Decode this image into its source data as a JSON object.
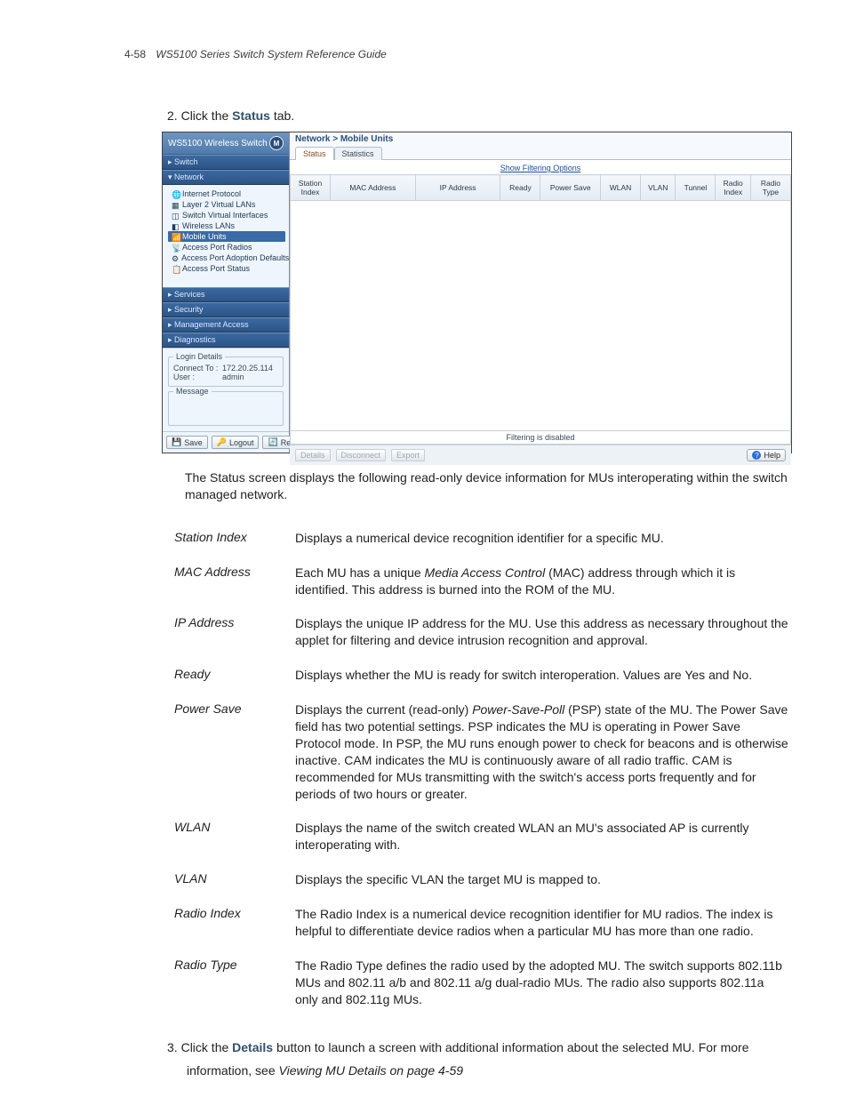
{
  "header": {
    "page_no": "4-58",
    "title": "WS5100 Series Switch System Reference Guide"
  },
  "step2": {
    "num": "2.",
    "pre": "Click the ",
    "bold": "Status",
    "post": " tab."
  },
  "shot": {
    "nav_title": "WS5100 Wireless Switch",
    "logo": "M",
    "band_switch": "▸  Switch",
    "band_network": "▾  Network",
    "tree": [
      "Internet Protocol",
      "Layer 2 Virtual LANs",
      "Switch Virtual Interfaces",
      "Wireless LANs",
      "Mobile Units",
      "Access Port Radios",
      "Access Port Adoption Defaults",
      "Access Port Status"
    ],
    "band_services": "▸  Services",
    "band_security": "▸  Security",
    "band_mgmt": "▸  Management Access",
    "band_diag": "▸  Diagnostics",
    "login_legend": "Login Details",
    "login_connect_lbl": "Connect To :",
    "login_connect_val": "172.20.25.114",
    "login_user_lbl": "User :",
    "login_user_val": "admin",
    "msg_legend": "Message",
    "btn_save": "Save",
    "btn_logout": "Logout",
    "btn_refresh": "Refresh",
    "crumbs": "Network > Mobile Units",
    "tab_status": "Status",
    "tab_stats": "Statistics",
    "filter_link": "Show Filtering Options",
    "cols": [
      "Station Index",
      "MAC Address",
      "IP Address",
      "Ready",
      "Power Save",
      "WLAN",
      "VLAN",
      "Tunnel",
      "Radio Index",
      "Radio Type"
    ],
    "filter_off": "Filtering is disabled",
    "btn_details": "Details",
    "btn_disconnect": "Disconnect",
    "btn_export": "Export",
    "btn_help": "Help"
  },
  "prose_status": "The Status screen displays the following read-only device information for MUs interoperating within the switch managed network.",
  "defs": [
    {
      "term": "Station Index",
      "def": "Displays a numerical device recognition identifier for a specific MU."
    },
    {
      "term": "MAC Address",
      "def": "Each MU has a unique <span class='it'>Media Access Control</span> (MAC) address through which it is identified. This address is burned into the ROM of the MU."
    },
    {
      "term": "IP Address",
      "def": "Displays the unique IP address for the MU. Use this address as necessary throughout the applet for filtering and device intrusion recognition and approval."
    },
    {
      "term": "Ready",
      "def": "Displays whether the MU is ready for switch interoperation. Values are Yes and No."
    },
    {
      "term": "Power Save",
      "def": "Displays the current (read-only) <span class='it'>Power-Save-Poll</span> (PSP) state of the MU. The Power Save field has two potential settings. PSP indicates the MU is operating in Power Save Protocol mode. In PSP, the MU runs enough power to check for beacons and is otherwise inactive. CAM indicates the MU is continuously aware of all radio traffic. CAM is recommended for MUs transmitting with the switch's access ports frequently and for periods of two hours or greater."
    },
    {
      "term": "WLAN",
      "def": "Displays the name of the switch created WLAN an MU's associated AP is currently interoperating with."
    },
    {
      "term": "VLAN",
      "def": "Displays the specific VLAN the target MU is mapped to."
    },
    {
      "term": "Radio Index",
      "def": "The Radio Index is a numerical device recognition identifier for MU radios. The index is helpful to differentiate device radios when a particular MU has more than one radio."
    },
    {
      "term": "Radio Type",
      "def": "The Radio Type defines the radio used by the adopted MU. The switch supports 802.11b MUs and 802.11 a/b and 802.11 a/g dual-radio MUs. The radio also supports 802.11a only and 802.11g MUs."
    }
  ],
  "step3": {
    "num": "3.",
    "pre": "Click the ",
    "bold": "Details",
    "post": " button to launch a screen with additional information about the selected MU. For more"
  },
  "step3b": {
    "pre": "information, see ",
    "it": "Viewing MU Details on page 4-59"
  }
}
